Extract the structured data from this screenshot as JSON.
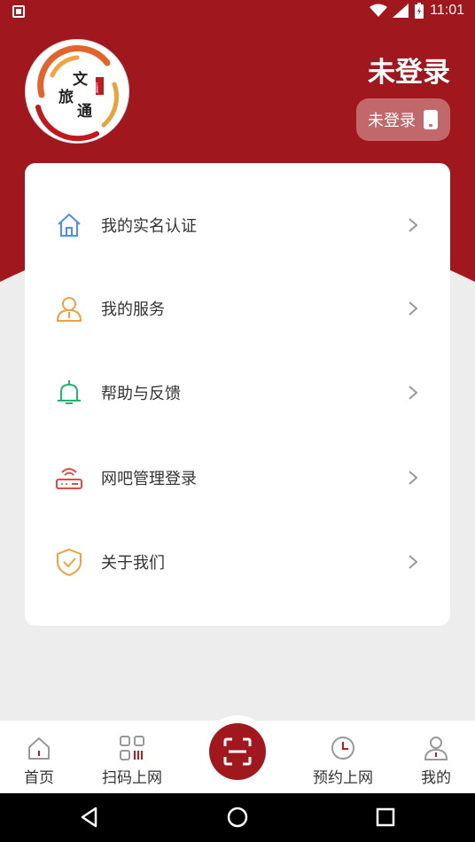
{
  "status_bar": {
    "time": "11:01"
  },
  "logo": {
    "line1": "文",
    "line2": "旅",
    "line3": "通",
    "seal": "文旅通"
  },
  "header": {
    "title": "未登录",
    "login_button": "未登录"
  },
  "menu": [
    {
      "label": "我的实名认证",
      "icon": "home-icon"
    },
    {
      "label": "我的服务",
      "icon": "user-icon"
    },
    {
      "label": "帮助与反馈",
      "icon": "bell-icon"
    },
    {
      "label": "网吧管理登录",
      "icon": "router-icon"
    },
    {
      "label": "关于我们",
      "icon": "shield-icon"
    }
  ],
  "tabs": [
    {
      "label": "首页",
      "icon": "house-icon"
    },
    {
      "label": "扫码上网",
      "icon": "qr-icon"
    },
    {
      "label": "预约上网",
      "icon": "clock-icon"
    },
    {
      "label": "我的",
      "icon": "person-icon"
    }
  ],
  "colors": {
    "brand": "#a0181d",
    "accent_blue": "#4a8ff0",
    "accent_orange": "#f0a040",
    "accent_green": "#26b36b",
    "accent_red": "#e24a4a"
  }
}
